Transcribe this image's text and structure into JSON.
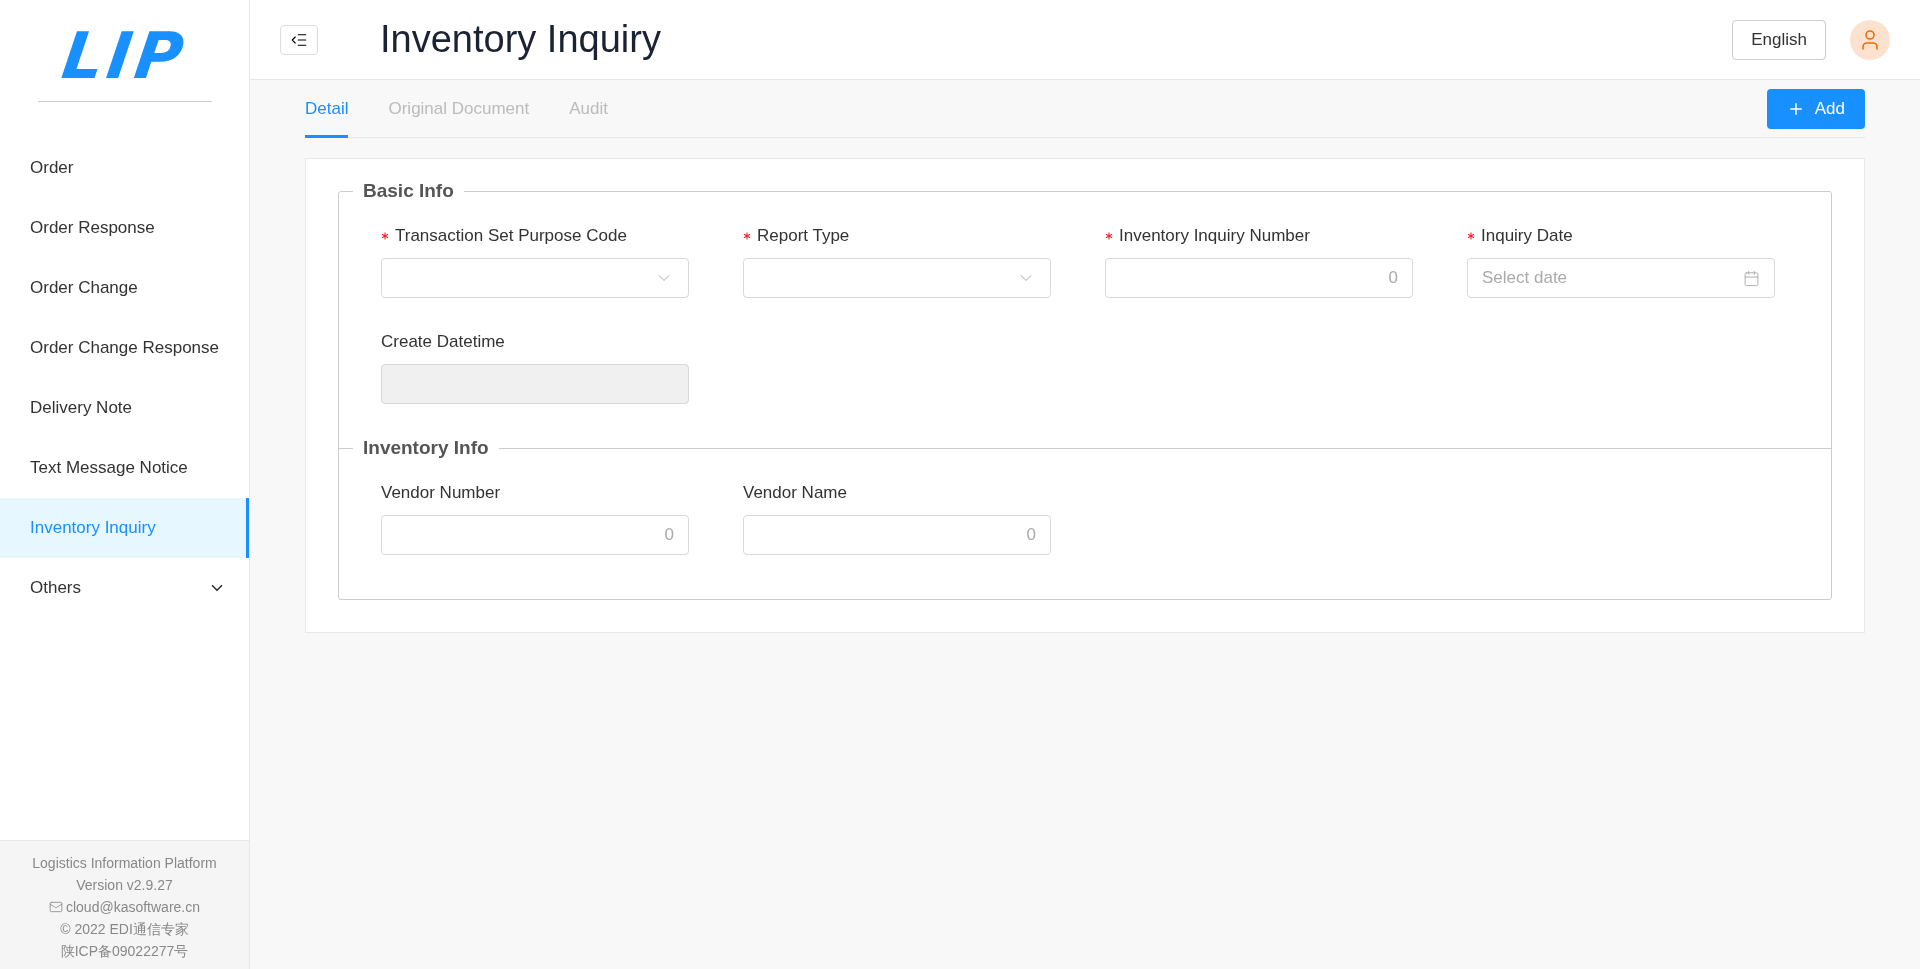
{
  "logo": "LIP",
  "sidebar": {
    "items": [
      {
        "label": "Order",
        "selected": false
      },
      {
        "label": "Order Response",
        "selected": false
      },
      {
        "label": "Order Change",
        "selected": false
      },
      {
        "label": "Order Change Response",
        "selected": false
      },
      {
        "label": "Delivery Note",
        "selected": false
      },
      {
        "label": "Text Message Notice",
        "selected": false
      },
      {
        "label": "Inventory Inquiry",
        "selected": true
      },
      {
        "label": "Others",
        "selected": false,
        "expanded": false
      }
    ],
    "footer": [
      "Logistics Information Platform",
      "Version v2.9.27",
      "cloud@kasoftware.cn",
      "© 2022 EDI通信专家",
      "陕ICP备09022277号"
    ]
  },
  "header": {
    "title": "Inventory Inquiry",
    "language": "English"
  },
  "tabs": [
    {
      "label": "Detail",
      "selected": true
    },
    {
      "label": "Original Document",
      "selected": false
    },
    {
      "label": "Audit",
      "selected": false
    }
  ],
  "add_button": "Add",
  "sections": [
    {
      "title": "Basic Info",
      "fields": [
        {
          "label": "Transaction Set Purpose Code",
          "required": true,
          "kind": "select"
        },
        {
          "label": "Report Type",
          "required": true,
          "kind": "select"
        },
        {
          "label": "Inventory Inquiry Number",
          "required": true,
          "kind": "number",
          "value": "0"
        },
        {
          "label": "Inquiry Date",
          "required": true,
          "kind": "date",
          "placeholder": "Select date"
        },
        {
          "label": "Create Datetime",
          "required": false,
          "kind": "disabled"
        }
      ]
    },
    {
      "title": "Inventory Info",
      "fields": [
        {
          "label": "Vendor Number",
          "required": false,
          "kind": "number",
          "value": "0"
        },
        {
          "label": "Vendor Name",
          "required": false,
          "kind": "number",
          "value": "0"
        }
      ]
    }
  ]
}
